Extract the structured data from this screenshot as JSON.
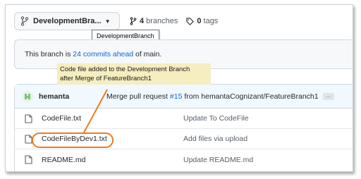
{
  "branch_selector": {
    "label": "DevelopmentBra...",
    "tooltip": "DevelopmentBranch"
  },
  "meta": {
    "branches_count": "4",
    "branches_label": "branches",
    "tags_count": "0",
    "tags_label": "tags"
  },
  "ahead": {
    "prefix": "This branch is",
    "link": "24 commits ahead",
    "suffix": "of main."
  },
  "callout": {
    "line1": "Code file added to the Development Branch",
    "line2": "after Merge of FeatureBranch1"
  },
  "latest_commit": {
    "author": "hemanta",
    "message_prefix": "Merge pull request",
    "pr_link": "#15",
    "message_suffix": "from hemantaCognizant/FeatureBranch1",
    "ellipsis": "…"
  },
  "files": [
    {
      "name": "CodeFile.txt",
      "message": "Update To CodeFile"
    },
    {
      "name": "CodeFileByDev1.txt",
      "message": "Add files via upload"
    },
    {
      "name": "README.md",
      "message": "Update README.md"
    }
  ],
  "colors": {
    "accent_link": "#0969da",
    "highlight": "#f07a18",
    "callout_bg": "#f6edc0"
  }
}
